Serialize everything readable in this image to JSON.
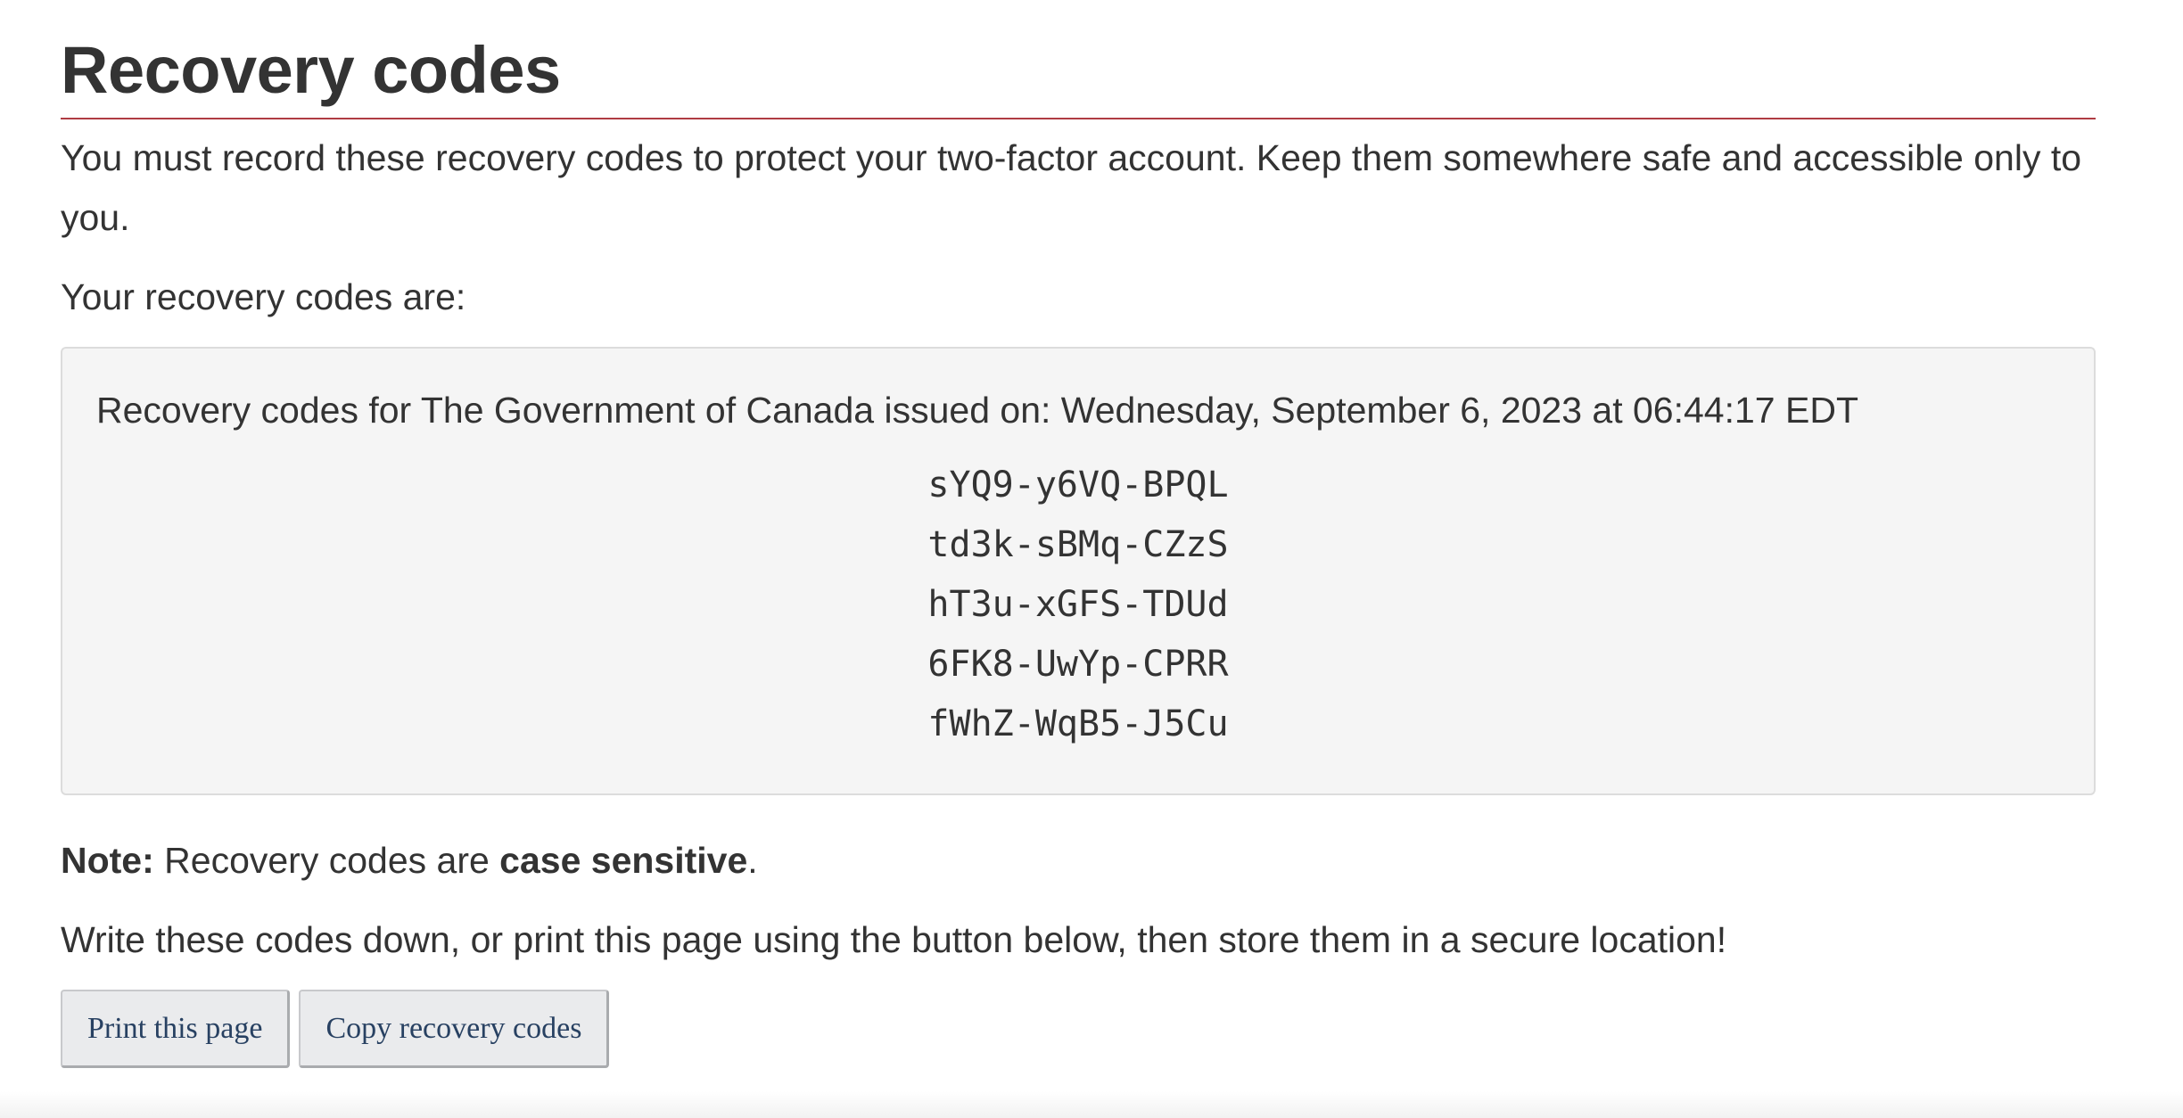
{
  "page": {
    "title": "Recovery codes",
    "intro": "You must record these recovery codes to protect your two-factor account. Keep them somewhere safe and accessible only to you.",
    "codes_intro": "Your recovery codes are:"
  },
  "codes_box": {
    "issued_line": "Recovery codes for The Government of Canada issued on: Wednesday, September 6, 2023 at 06:44:17 EDT",
    "codes": [
      "sYQ9-y6VQ-BPQL",
      "td3k-sBMq-CZzS",
      "hT3u-xGFS-TDUd",
      "6FK8-UwYp-CPRR",
      "fWhZ-WqB5-J5Cu"
    ]
  },
  "note": {
    "label": "Note:",
    "text_before": " Recovery codes are ",
    "emphasis": "case sensitive",
    "text_after": "."
  },
  "instructions": "Write these codes down, or print this page using the button below, then store them in a secure location!",
  "buttons": {
    "print_label": "Print this page",
    "copy_label": "Copy recovery codes"
  },
  "colors": {
    "title_rule": "#af3c43",
    "button_text": "#284162",
    "codes_box_bg": "#f5f5f5"
  }
}
